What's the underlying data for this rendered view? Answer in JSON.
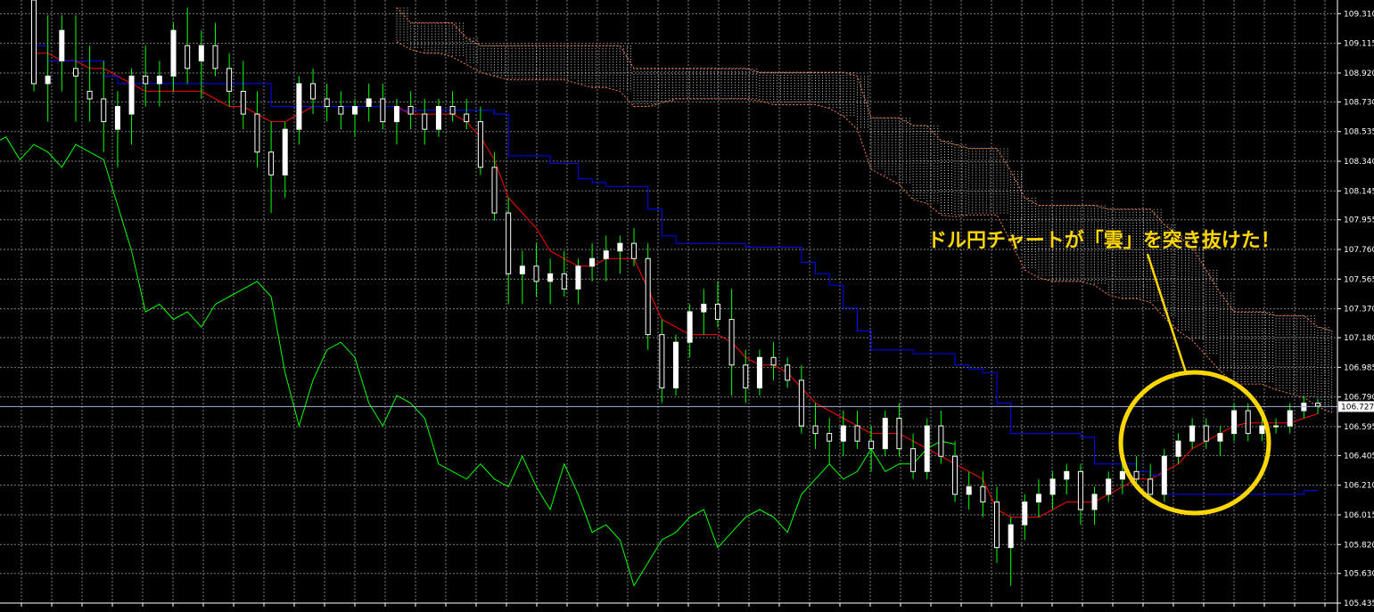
{
  "chart_data": {
    "type": "candlestick",
    "instrument": "USD/JPY",
    "indicator": "Ichimoku",
    "ylim": [
      105.435,
      109.4
    ],
    "y_ticks": [
      "109.310",
      "109.115",
      "108.920",
      "108.730",
      "108.535",
      "108.340",
      "108.145",
      "107.955",
      "107.760",
      "107.565",
      "107.370",
      "107.180",
      "106.985",
      "106.790",
      "106.595",
      "106.405",
      "106.210",
      "106.015",
      "105.820",
      "105.630",
      "105.435"
    ],
    "current_price": "106.727",
    "current_price_value": 106.727,
    "grid": true,
    "colors": {
      "background": "#000000",
      "grid": "#7f7f7f",
      "candle_up": "#ffffff",
      "candle_wick": "#00ff00",
      "tenkan": "#ff0000",
      "kijun": "#0000ff",
      "chikou": "#00ff00",
      "cloud": "#ffffff",
      "cloud_edge": "#ff8040",
      "annotation": "#ffd700"
    },
    "candles": [
      [
        109.4,
        109.4,
        108.8,
        108.85
      ],
      [
        108.85,
        109.3,
        108.6,
        108.9
      ],
      [
        109.0,
        109.3,
        108.8,
        109.2
      ],
      [
        108.95,
        109.3,
        108.6,
        108.9
      ],
      [
        108.8,
        109.1,
        108.6,
        108.75
      ],
      [
        108.75,
        109.0,
        108.4,
        108.6
      ],
      [
        108.55,
        108.8,
        108.3,
        108.7
      ],
      [
        108.65,
        108.95,
        108.45,
        108.9
      ],
      [
        108.9,
        109.1,
        108.7,
        108.85
      ],
      [
        108.85,
        109.0,
        108.7,
        108.9
      ],
      [
        108.9,
        109.25,
        108.8,
        109.2
      ],
      [
        109.1,
        109.35,
        108.85,
        108.95
      ],
      [
        109.0,
        109.2,
        108.75,
        109.1
      ],
      [
        109.1,
        109.25,
        108.9,
        108.95
      ],
      [
        108.95,
        109.05,
        108.7,
        108.8
      ],
      [
        108.8,
        109.0,
        108.55,
        108.65
      ],
      [
        108.65,
        108.8,
        108.3,
        108.4
      ],
      [
        108.4,
        108.6,
        108.0,
        108.25
      ],
      [
        108.25,
        108.6,
        108.1,
        108.55
      ],
      [
        108.55,
        108.9,
        108.45,
        108.85
      ],
      [
        108.85,
        108.95,
        108.65,
        108.75
      ],
      [
        108.75,
        108.85,
        108.6,
        108.7
      ],
      [
        108.7,
        108.8,
        108.55,
        108.65
      ],
      [
        108.65,
        108.75,
        108.5,
        108.7
      ],
      [
        108.7,
        108.85,
        108.6,
        108.75
      ],
      [
        108.75,
        108.85,
        108.55,
        108.6
      ],
      [
        108.6,
        108.75,
        108.45,
        108.7
      ],
      [
        108.7,
        108.8,
        108.55,
        108.65
      ],
      [
        108.65,
        108.75,
        108.45,
        108.55
      ],
      [
        108.55,
        108.75,
        108.5,
        108.7
      ],
      [
        108.7,
        108.8,
        108.6,
        108.65
      ],
      [
        108.65,
        108.75,
        108.55,
        108.6
      ],
      [
        108.6,
        108.7,
        108.25,
        108.3
      ],
      [
        108.3,
        108.4,
        107.95,
        108.0
      ],
      [
        108.0,
        108.1,
        107.4,
        107.6
      ],
      [
        107.6,
        107.75,
        107.4,
        107.65
      ],
      [
        107.65,
        107.8,
        107.45,
        107.55
      ],
      [
        107.55,
        107.7,
        107.4,
        107.6
      ],
      [
        107.6,
        107.75,
        107.45,
        107.5
      ],
      [
        107.5,
        107.7,
        107.4,
        107.65
      ],
      [
        107.65,
        107.8,
        107.55,
        107.7
      ],
      [
        107.7,
        107.85,
        107.55,
        107.75
      ],
      [
        107.75,
        107.85,
        107.6,
        107.8
      ],
      [
        107.8,
        107.9,
        107.65,
        107.7
      ],
      [
        107.7,
        107.8,
        107.1,
        107.2
      ],
      [
        107.2,
        107.3,
        106.75,
        106.85
      ],
      [
        106.85,
        107.2,
        106.8,
        107.15
      ],
      [
        107.15,
        107.4,
        107.05,
        107.35
      ],
      [
        107.35,
        107.5,
        107.2,
        107.4
      ],
      [
        107.4,
        107.55,
        107.25,
        107.3
      ],
      [
        107.3,
        107.5,
        106.8,
        107.0
      ],
      [
        107.0,
        107.1,
        106.75,
        106.85
      ],
      [
        106.85,
        107.1,
        106.8,
        107.05
      ],
      [
        107.05,
        107.15,
        106.9,
        107.0
      ],
      [
        107.0,
        107.05,
        106.85,
        106.9
      ],
      [
        106.9,
        107.0,
        106.55,
        106.6
      ],
      [
        106.6,
        106.75,
        106.45,
        106.55
      ],
      [
        106.55,
        106.65,
        106.35,
        106.5
      ],
      [
        106.5,
        106.7,
        106.4,
        106.6
      ],
      [
        106.6,
        106.7,
        106.45,
        106.5
      ],
      [
        106.5,
        106.6,
        106.3,
        106.45
      ],
      [
        106.45,
        106.7,
        106.4,
        106.65
      ],
      [
        106.65,
        106.75,
        106.4,
        106.45
      ],
      [
        106.45,
        106.55,
        106.25,
        106.3
      ],
      [
        106.3,
        106.65,
        106.25,
        106.6
      ],
      [
        106.6,
        106.7,
        106.35,
        106.4
      ],
      [
        106.4,
        106.5,
        106.1,
        106.15
      ],
      [
        106.15,
        106.3,
        106.05,
        106.2
      ],
      [
        106.2,
        106.3,
        106.0,
        106.1
      ],
      [
        106.1,
        106.2,
        105.7,
        105.8
      ],
      [
        105.8,
        106.0,
        105.55,
        105.95
      ],
      [
        105.95,
        106.15,
        105.85,
        106.1
      ],
      [
        106.1,
        106.25,
        106.0,
        106.15
      ],
      [
        106.15,
        106.3,
        106.05,
        106.25
      ],
      [
        106.25,
        106.35,
        106.15,
        106.3
      ],
      [
        106.3,
        106.35,
        105.95,
        106.05
      ],
      [
        106.05,
        106.2,
        105.95,
        106.15
      ],
      [
        106.15,
        106.3,
        106.1,
        106.25
      ],
      [
        106.25,
        106.35,
        106.15,
        106.3
      ],
      [
        106.3,
        106.4,
        106.2,
        106.25
      ],
      [
        106.25,
        106.35,
        106.1,
        106.15
      ],
      [
        106.15,
        106.45,
        106.1,
        106.4
      ],
      [
        106.4,
        106.55,
        106.35,
        106.5
      ],
      [
        106.5,
        106.65,
        106.45,
        106.6
      ],
      [
        106.6,
        106.65,
        106.45,
        106.5
      ],
      [
        106.5,
        106.6,
        106.4,
        106.55
      ],
      [
        106.55,
        106.75,
        106.5,
        106.7
      ],
      [
        106.7,
        106.75,
        106.5,
        106.55
      ],
      [
        106.55,
        106.65,
        106.5,
        106.6
      ],
      [
        106.6,
        106.65,
        106.55,
        106.6
      ],
      [
        106.6,
        106.75,
        106.55,
        106.7
      ],
      [
        106.7,
        106.8,
        106.65,
        106.75
      ],
      [
        106.75,
        106.78,
        106.68,
        106.73
      ]
    ],
    "tenkan": [
      109.05,
      109.05,
      109.0,
      109.0,
      108.95,
      108.95,
      108.9,
      108.85,
      108.8,
      108.8,
      108.8,
      108.8,
      108.8,
      108.75,
      108.7,
      108.7,
      108.65,
      108.6,
      108.6,
      108.65,
      108.7,
      108.7,
      108.7,
      108.7,
      108.7,
      108.7,
      108.7,
      108.65,
      108.65,
      108.65,
      108.65,
      108.6,
      108.5,
      108.35,
      108.1,
      108.0,
      107.9,
      107.75,
      107.7,
      107.65,
      107.65,
      107.7,
      107.7,
      107.7,
      107.5,
      107.3,
      107.25,
      107.2,
      107.2,
      107.2,
      107.15,
      107.05,
      107.0,
      107.0,
      106.95,
      106.85,
      106.75,
      106.7,
      106.65,
      106.6,
      106.55,
      106.55,
      106.55,
      106.5,
      106.45,
      106.4,
      106.35,
      106.3,
      106.25,
      106.05,
      106.0,
      106.0,
      106.0,
      106.05,
      106.1,
      106.1,
      106.1,
      106.15,
      106.2,
      106.25,
      106.25,
      106.3,
      106.35,
      106.45,
      106.5,
      106.55,
      106.6,
      106.62,
      106.62,
      106.62,
      106.62,
      106.65,
      106.68
    ]
  },
  "annotation": {
    "text": "ドル円チャートが「雲」を突き抜けた！"
  }
}
